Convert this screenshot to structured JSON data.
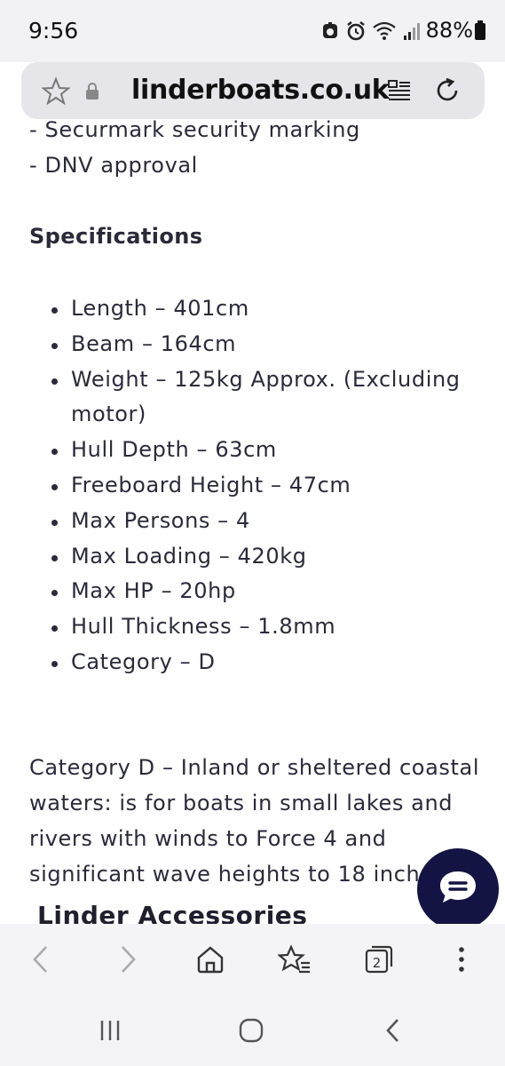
{
  "status_bar": {
    "time": "9:56",
    "battery": "88%",
    "icons": [
      "alarm-badge-icon",
      "alarm-clock-icon",
      "wifi-icon",
      "signal-icon",
      "battery-icon"
    ]
  },
  "browser": {
    "url": "linderboats.co.uk",
    "icons": [
      "star-icon",
      "lock-icon",
      "reader-mode-icon",
      "reload-icon"
    ]
  },
  "content": {
    "top_lines": [
      "- Securmark security marking",
      "- DNV approval"
    ],
    "specifications_heading": "Specifications",
    "specifications": [
      "Length  – 401cm",
      "Beam – 164cm",
      "Weight – 125kg Approx. (Excluding motor)",
      "Hull Depth – 63cm",
      "Freeboard Height – 47cm",
      "Max Persons – 4",
      "Max Loading – 420kg",
      "Max HP – 20hp",
      "Hull Thickness – 1.8mm",
      "Category – D"
    ],
    "category_paragraph_lines": [
      "Category D – Inland or sheltered coastal",
      "waters: is for boats in small lakes and",
      "rivers with winds to Force 4 and",
      "significant wave heights to 18 inch"
    ],
    "next_heading": "Linder Accessories"
  },
  "toolbar": {
    "tab_count": "2",
    "icons": [
      "back-icon",
      "forward-icon",
      "home-icon",
      "bookmarks-icon",
      "tabs-icon",
      "more-icon"
    ]
  },
  "nav": {
    "icons": [
      "recents-icon",
      "home-nav-icon",
      "back-nav-icon"
    ]
  },
  "colors": {
    "accent_fab": "#141444",
    "text": "#2a2a3a",
    "chrome_bg": "#f4f4f6"
  }
}
